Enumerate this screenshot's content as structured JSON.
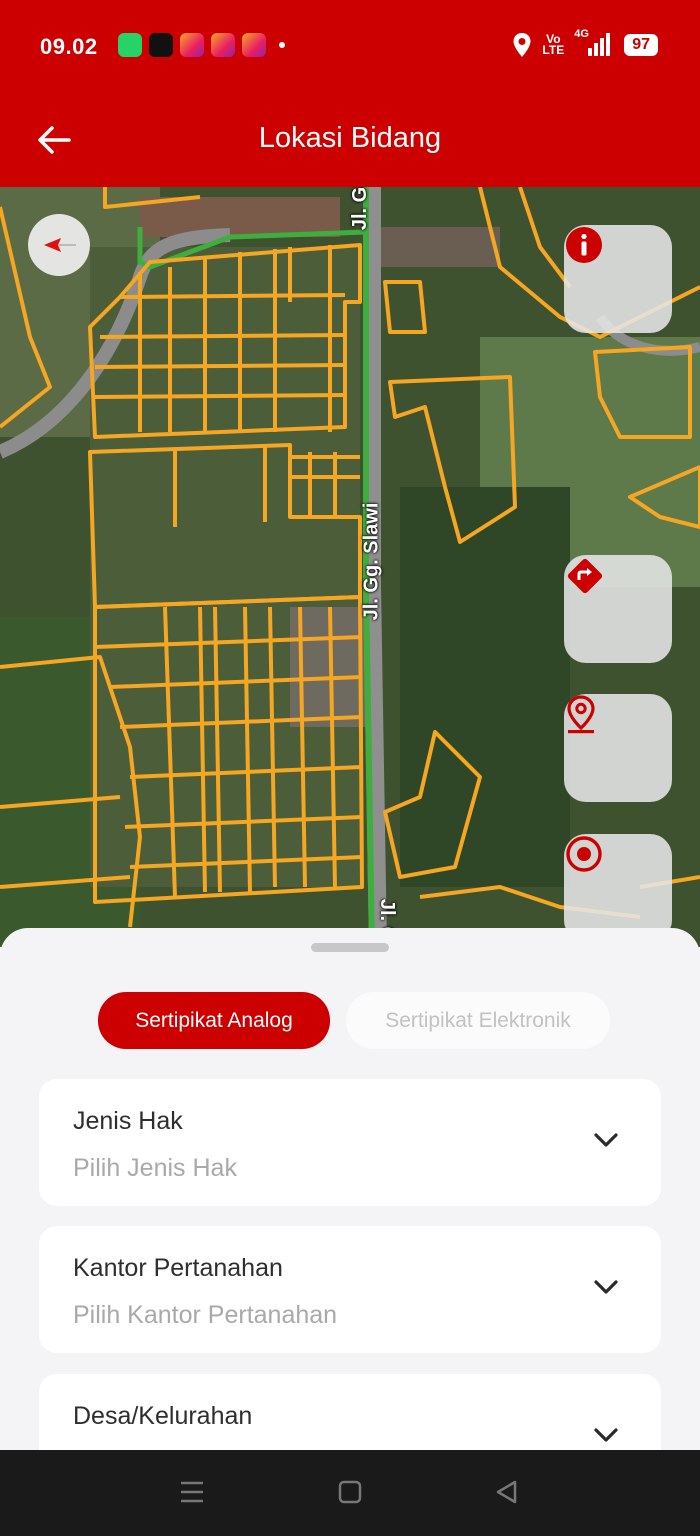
{
  "status_bar": {
    "time": "09.02",
    "notifications": [
      "whatsapp-icon",
      "tiktok-icon",
      "instagram-icon",
      "instagram-icon",
      "instagram-icon"
    ],
    "network_line1": "Vo",
    "network_line2": "LTE",
    "signal": "4G",
    "battery": "97"
  },
  "app_bar": {
    "title": "Lokasi Bidang",
    "back_icon": "arrow-left-icon"
  },
  "map": {
    "road_label_1": "Jl. Gg. Slawi",
    "road_label_top": "Jl. G",
    "road_label_bottom": "Jl. G",
    "parcel_color": "#f5a623",
    "road_color": "#3fae3f",
    "buttons": [
      "info-icon",
      "directions-icon",
      "location-pin-icon",
      "my-location-icon"
    ]
  },
  "sheet": {
    "tabs": [
      {
        "label": "Sertipikat Analog",
        "active": true
      },
      {
        "label": "Sertipikat Elektronik",
        "active": false
      }
    ],
    "fields": [
      {
        "label": "Jenis Hak",
        "placeholder": "Pilih Jenis Hak"
      },
      {
        "label": "Kantor Pertanahan",
        "placeholder": "Pilih Kantor Pertanahan"
      },
      {
        "label": "Desa/Kelurahan",
        "placeholder": ""
      }
    ]
  },
  "colors": {
    "brand": "#cc0000",
    "background": "#f4f4f6"
  }
}
